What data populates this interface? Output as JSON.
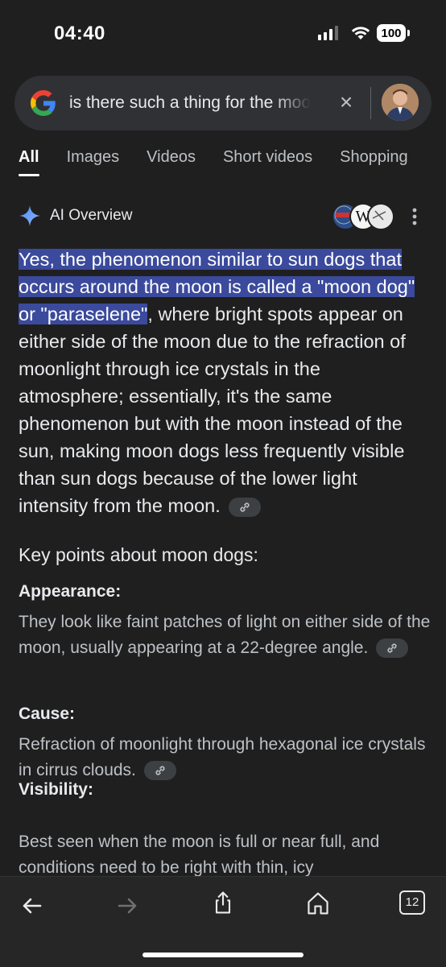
{
  "status_bar": {
    "time": "04:40",
    "battery": "100"
  },
  "search": {
    "query": "is there such a thing for the moon dogs",
    "clear_icon": "close-icon"
  },
  "tabs": [
    {
      "label": "All",
      "active": true
    },
    {
      "label": "Images"
    },
    {
      "label": "Videos"
    },
    {
      "label": "Short videos"
    },
    {
      "label": "Shopping"
    }
  ],
  "ai_overview": {
    "label": "AI Overview",
    "answer_highlighted": "Yes, the phenomenon similar to sun dogs that occurs around the moon is called a \"moon dog\" or \"paraselene\"",
    "answer_rest": ", where bright spots appear on either side of the moon due to the refraction of moonlight through ice crystals in the atmosphere; essentially, it's the same phenomenon but with the moon instead of the sun, making moon dogs less frequently visible than sun dogs because of the lower light intensity from the moon.",
    "key_points_heading": "Key points about moon dogs:",
    "points": [
      {
        "title": "Appearance:",
        "text": "They look like faint patches of light on either side of the moon, usually appearing at a 22-degree angle."
      },
      {
        "title": "Cause:",
        "text": "Refraction of moonlight through hexagonal ice crystals in cirrus clouds."
      },
      {
        "title": "Visibility:",
        "text": "Best seen when the moon is full or near full, and conditions need to be right with thin, icy"
      }
    ]
  },
  "toolbar": {
    "tabs_count": "12"
  },
  "colors": {
    "background": "#1f1f1f",
    "highlight": "#3b4a9c",
    "search_bg": "#303134"
  }
}
